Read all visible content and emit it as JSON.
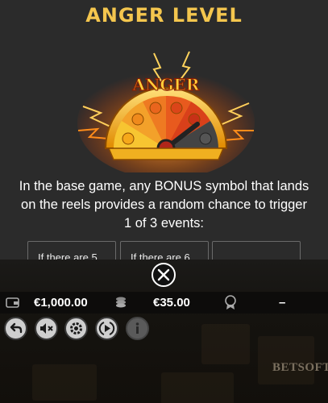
{
  "help": {
    "title": "ANGER LEVEL",
    "meter_label": "ANGER",
    "description": "In the base game, any BONUS symbol that lands on the reels provides a random chance to trigger 1 of 3 events:",
    "cards": [
      "If there are 5",
      "If there are 6",
      ""
    ]
  },
  "info_bar": {
    "balance": "€1,000.00",
    "bet": "€35.00",
    "win": "–"
  },
  "brand": "BETSOFT",
  "icons": [
    "wallet-icon",
    "coins-icon",
    "award-icon",
    "close-icon",
    "back-icon",
    "mute-icon",
    "settings-icon",
    "autoplay-icon",
    "info-icon"
  ]
}
